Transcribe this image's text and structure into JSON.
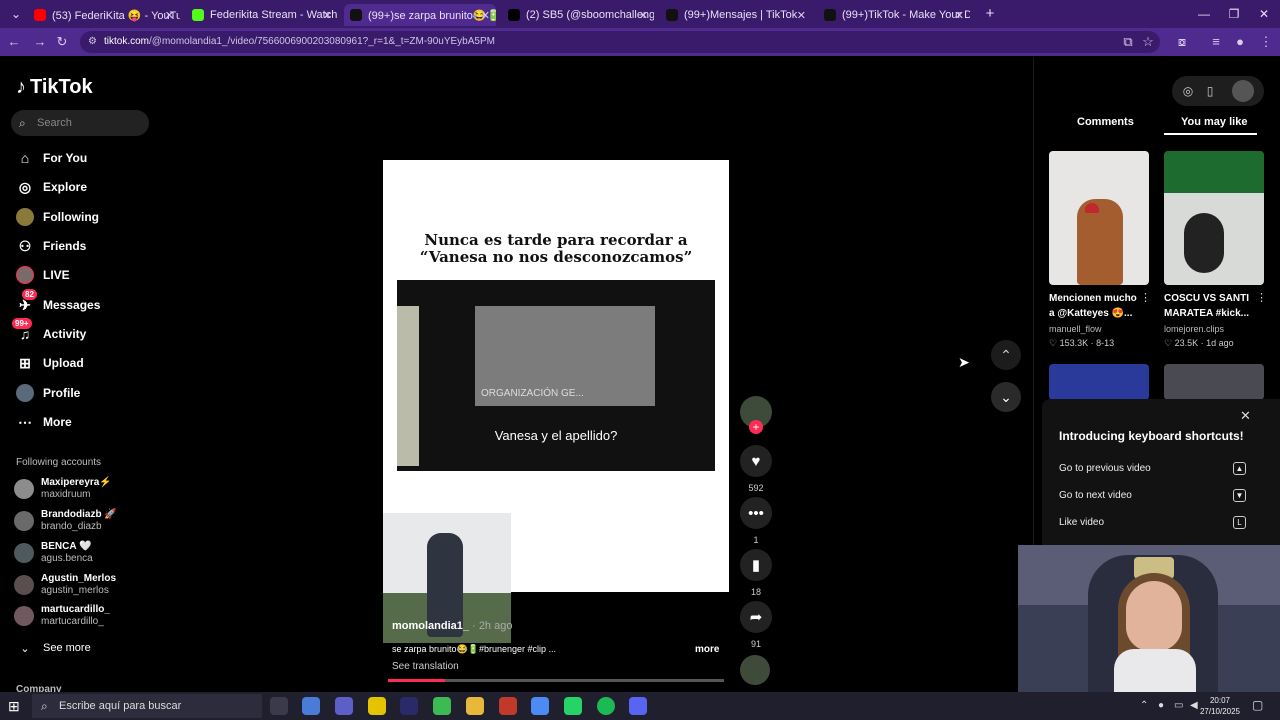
{
  "browser": {
    "tabs": [
      {
        "title": "(53) FederiKita 😝 - YouTube",
        "favicon_color": "#ff0000"
      },
      {
        "title": "Federikita Stream - Watch Live",
        "favicon_color": "#53fc18"
      },
      {
        "title": "(99+)se zarpa brunito😂🔋 ▮",
        "favicon_color": "#111111"
      },
      {
        "title": "(2) SB5 (@sboomchallenge) / X",
        "favicon_color": "#000000"
      },
      {
        "title": "(99+)Mensajes | TikTok",
        "favicon_color": "#111111"
      },
      {
        "title": "(99+)TikTok - Make Your Day",
        "favicon_color": "#111111"
      }
    ],
    "new_tab": "+",
    "url_domain": "tiktok.com",
    "url_path": "/@momolandia1_/video/7566006900203080961?_r=1&_t=ZM-90uYEybA5PM"
  },
  "sidebar": {
    "logo_text": "TikTok",
    "search_placeholder": "Search",
    "nav": [
      {
        "label": "For You",
        "icon": "home-icon"
      },
      {
        "label": "Explore",
        "icon": "compass-icon"
      },
      {
        "label": "Following",
        "icon": "avatar"
      },
      {
        "label": "Friends",
        "icon": "friends-icon"
      },
      {
        "label": "LIVE",
        "icon": "avatar"
      },
      {
        "label": "Messages",
        "icon": "message-icon",
        "badge": "82"
      },
      {
        "label": "Activity",
        "icon": "bell-icon",
        "badge": "99+"
      },
      {
        "label": "Upload",
        "icon": "plus-square-icon"
      },
      {
        "label": "Profile",
        "icon": "avatar"
      },
      {
        "label": "More",
        "icon": "more-icon"
      }
    ],
    "following_title": "Following accounts",
    "accounts": [
      {
        "name": "Maxipereyra⚡",
        "handle": "maxidruum"
      },
      {
        "name": "Brandodiazb 🚀",
        "handle": "brando_diazb"
      },
      {
        "name": "BENCA 🤍",
        "handle": "agus.benca"
      },
      {
        "name": "Agustin_Merlos",
        "handle": "agustin_merlos"
      },
      {
        "name": "martucardillo_",
        "handle": "martucardillo_"
      }
    ],
    "see_more": "See more",
    "company": "Company"
  },
  "video": {
    "overlay_title_line1": "Nunca es tarde para recordar a",
    "overlay_title_line2": "“Vanesa no nos desconozcamos”",
    "clip_org_text": "ORGANIZACIÓN GE...",
    "clip_subtitle": "Vanesa y el apellido?",
    "author": "momolandia1_",
    "time_ago": "· 2h ago",
    "caption": "se zarpa brunito😂🔋#brunenger #clip ...",
    "more_label": "more",
    "see_translation": "See translation",
    "progress": 0.17
  },
  "actions": {
    "likes": "592",
    "comments": "1",
    "saves": "18",
    "shares": "91"
  },
  "right_panel": {
    "tab_comments": "Comments",
    "tab_you_may_like": "You may like",
    "cards": [
      {
        "title": "Mencionen mucho a @Katteyes 😍...",
        "user": "manuell_flow",
        "stats": "♡ 153.3K · 8-13"
      },
      {
        "title": "COSCU VS SANTI MARATEA #kick...",
        "user": "lomejoren.clips",
        "stats": "♡ 23.5K · 1d ago"
      }
    ]
  },
  "shortcuts_popup": {
    "title": "Introducing keyboard shortcuts!",
    "rows": [
      {
        "label": "Go to previous video",
        "key": "▲"
      },
      {
        "label": "Go to next video",
        "key": "▼"
      },
      {
        "label": "Like video",
        "key": "L"
      }
    ]
  },
  "taskbar": {
    "search_placeholder": "Escribe aquí para buscar",
    "time": "20:07",
    "date": "27/10/2025"
  }
}
